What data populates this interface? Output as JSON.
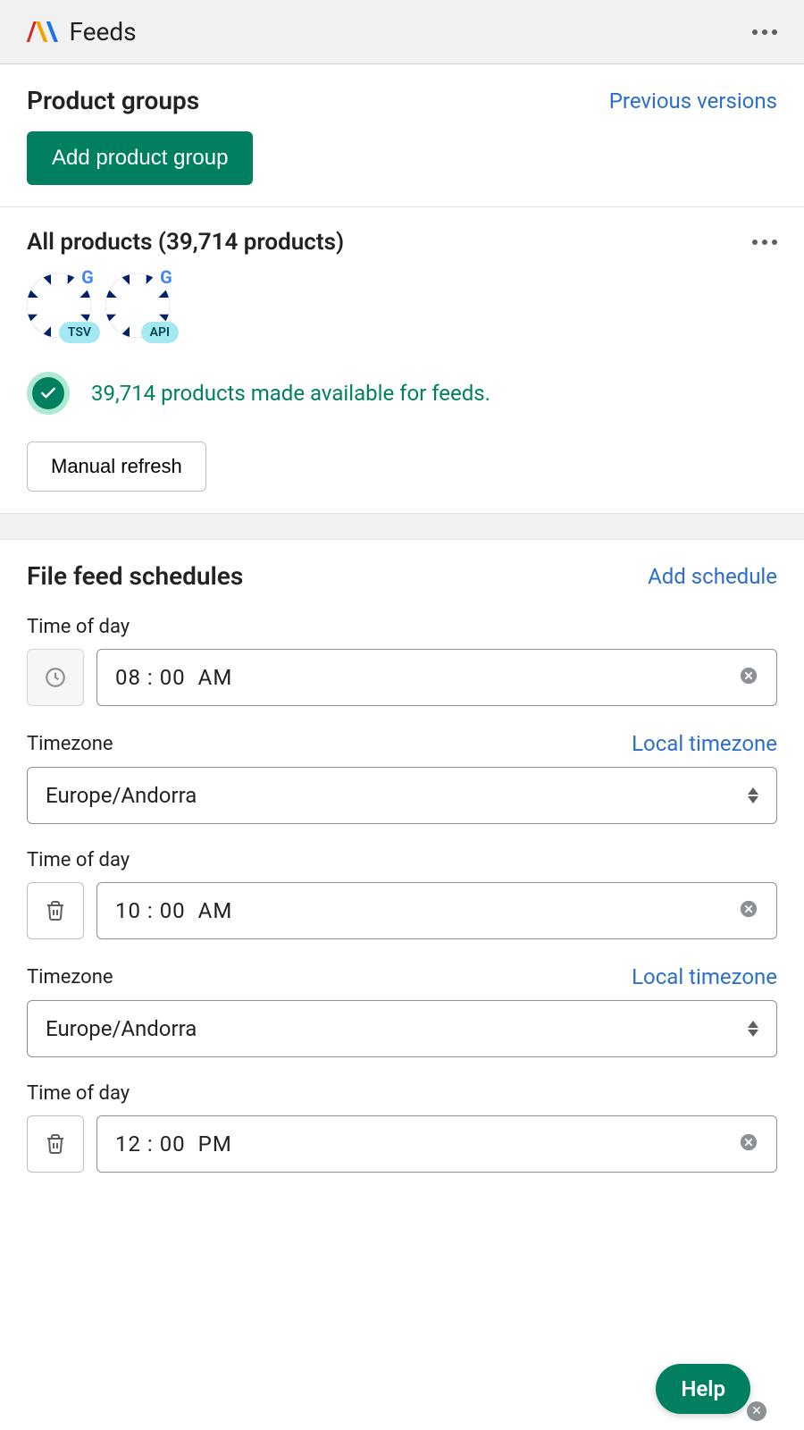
{
  "header": {
    "title": "Feeds"
  },
  "product_groups": {
    "heading": "Product groups",
    "previous_versions": "Previous versions",
    "add_button": "Add product group"
  },
  "group": {
    "title": "All products (39,714 products)",
    "flags": [
      {
        "country": "UK",
        "tag": "TSV"
      },
      {
        "country": "UK",
        "tag": "API"
      }
    ],
    "status_text": "39,714 products made available for feeds.",
    "manual_refresh": "Manual refresh"
  },
  "schedules": {
    "heading": "File feed schedules",
    "add_link": "Add schedule",
    "time_label": "Time of day",
    "timezone_label": "Timezone",
    "local_timezone": "Local timezone",
    "entries": [
      {
        "time": "08 : 00",
        "ampm": "AM",
        "timezone": "Europe/Andorra",
        "leading_icon": "clock"
      },
      {
        "time": "10 : 00",
        "ampm": "AM",
        "timezone": "Europe/Andorra",
        "leading_icon": "trash"
      },
      {
        "time": "12 : 00",
        "ampm": "PM",
        "timezone": "Europe/Andorra",
        "leading_icon": "trash"
      }
    ]
  },
  "help": {
    "label": "Help"
  }
}
